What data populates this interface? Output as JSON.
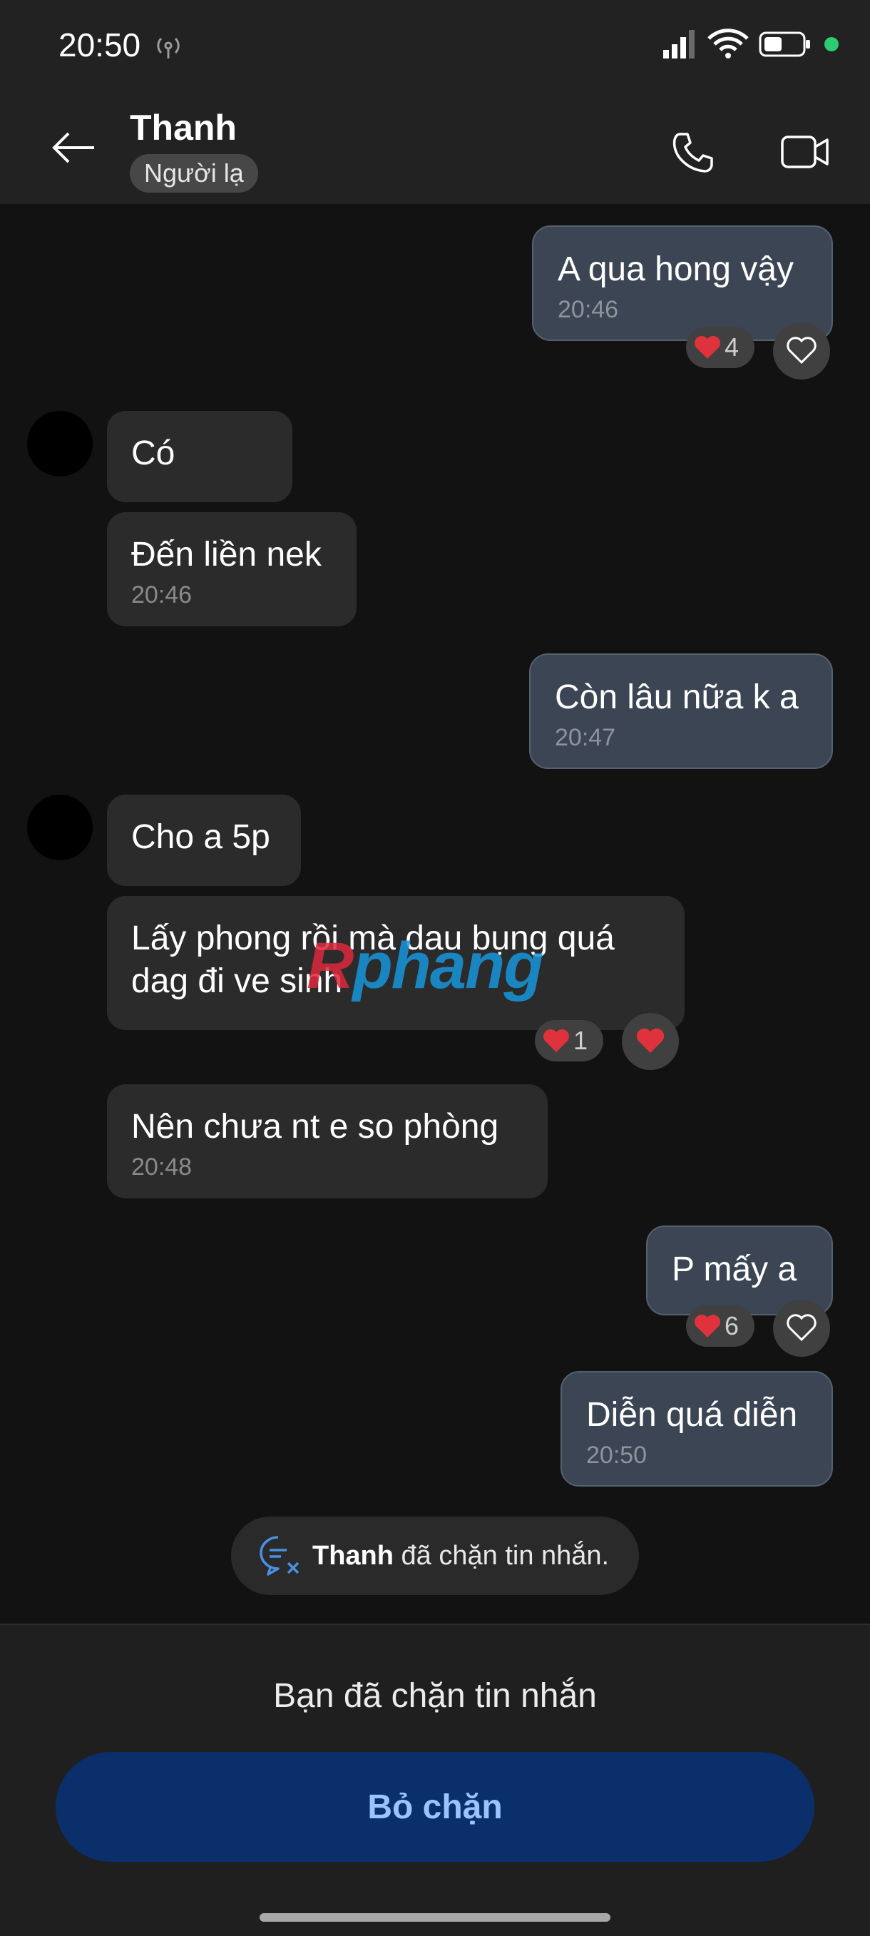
{
  "status_bar": {
    "time": "20:50"
  },
  "header": {
    "contact_name": "Thanh",
    "badge": "Người lạ"
  },
  "messages": [
    {
      "direction": "out",
      "text": "A qua hong vậy",
      "time": "20:46",
      "reaction_count": "4"
    },
    {
      "direction": "in",
      "text": "Có"
    },
    {
      "direction": "in",
      "text": "Đến liền nek",
      "time": "20:46"
    },
    {
      "direction": "out",
      "text": "Còn lâu nữa k a",
      "time": "20:47"
    },
    {
      "direction": "in",
      "text": "Cho a 5p"
    },
    {
      "direction": "in",
      "text_line1": "Lấy phong rồi mà dau bụng quá",
      "text_line2": "dag đi ve sinh",
      "reaction_count": "1"
    },
    {
      "direction": "in",
      "text": "Nên chưa nt e so phòng",
      "time": "20:48"
    },
    {
      "direction": "out",
      "text": "P mấy a",
      "reaction_count": "6"
    },
    {
      "direction": "out",
      "text": "Diễn quá diễn",
      "time": "20:50"
    }
  ],
  "watermark": {
    "first": "R",
    "rest": "phang"
  },
  "system_notice": {
    "name": "Thanh",
    "text": " đã chặn tin nhắn."
  },
  "footer": {
    "blocked_text": "Bạn đã chặn tin nhắn",
    "unblock_label": "Bỏ chặn"
  },
  "colors": {
    "outgoing_bubble": "#3b4554",
    "incoming_bubble": "#2b2b2b",
    "heart": "#e0323c",
    "unblock_button": "#0b2f6b",
    "unblock_text": "#9cc3ff"
  }
}
